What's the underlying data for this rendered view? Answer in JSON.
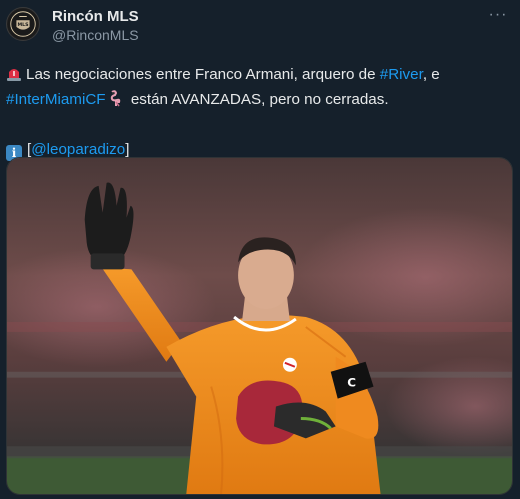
{
  "author": {
    "name": "Rincón MLS",
    "handle": "@RinconMLS",
    "avatar_icon": "rincon-mls-logo-icon"
  },
  "menu": {
    "more_label": "···"
  },
  "tweet": {
    "line1_text": "Las negociaciones entre Franco Armani, arquero de ",
    "line1_link": "#River",
    "line1_end": ", e",
    "line2_link": "#InterMiamiCF",
    "line2_text": "están AVANZADAS, pero no cerradas.",
    "line3_open": "[",
    "line3_link": "@leoparadizo",
    "line3_close": "]",
    "emoji_siren": "rotating-light-icon",
    "emoji_flamingo": "flamingo-icon",
    "emoji_info": "information-icon"
  },
  "media": {
    "description_icon": "goalkeeper-photo-image"
  },
  "colors": {
    "background": "#15202b",
    "text": "#e7e9ea",
    "secondary": "#8b98a5",
    "link": "#1d9bf0",
    "jersey": "#f28a1c"
  }
}
